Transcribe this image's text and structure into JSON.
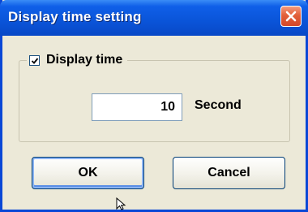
{
  "window": {
    "title": "Display time setting",
    "close_icon": "close-icon"
  },
  "group": {
    "label": "Display time",
    "checked": true
  },
  "time_input": {
    "value": "10",
    "unit": "Second"
  },
  "buttons": {
    "ok_label": "OK",
    "cancel_label": "Cancel"
  },
  "colors": {
    "titlebar": "#0a54d8",
    "close_button": "#e2603a",
    "dialog_background": "#ece9d8"
  }
}
